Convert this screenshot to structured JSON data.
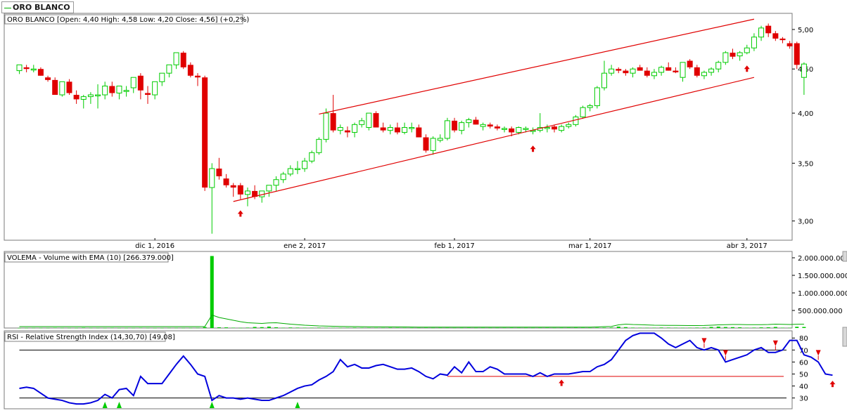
{
  "window_title": "ORO BLANCO",
  "colors": {
    "up": "#00cc00",
    "down": "#e00000",
    "line": "#0000dd",
    "trend": "#e00000",
    "ema": "#00aa00"
  },
  "chart_data": [
    {
      "type": "candlestick",
      "title": "ORO BLANCO [Open: 4,40  High: 4,58  Low: 4,20  Close: 4,56] (+0,2%)",
      "y_scale": "log",
      "ylim": [
        2.85,
        5.22
      ],
      "y_ticks": [
        "5,00",
        "4,50",
        "4,00",
        "3,50",
        "3,00"
      ],
      "y_tick_values": [
        5.0,
        4.5,
        4.0,
        3.5,
        3.0
      ],
      "x_tick_labels": [
        "dic 1, 2016",
        "ene 2, 2017",
        "feb 1, 2017",
        "mar 1, 2017",
        "abr 3, 2017"
      ],
      "x_tick_index": [
        19,
        40,
        61,
        80,
        102
      ],
      "candles": [
        [
          4.48,
          4.55,
          4.44,
          4.55
        ],
        [
          4.52,
          4.55,
          4.46,
          4.5
        ],
        [
          4.5,
          4.55,
          4.46,
          4.5
        ],
        [
          4.5,
          4.52,
          4.42,
          4.42
        ],
        [
          4.4,
          4.42,
          4.35,
          4.37
        ],
        [
          4.37,
          4.4,
          4.2,
          4.2
        ],
        [
          4.2,
          4.35,
          4.18,
          4.35
        ],
        [
          4.35,
          4.38,
          4.2,
          4.22
        ],
        [
          4.2,
          4.25,
          4.1,
          4.15
        ],
        [
          4.15,
          4.2,
          4.05,
          4.18
        ],
        [
          4.18,
          4.23,
          4.1,
          4.2
        ],
        [
          4.2,
          4.32,
          4.05,
          4.2
        ],
        [
          4.2,
          4.35,
          4.15,
          4.3
        ],
        [
          4.3,
          4.35,
          4.18,
          4.22
        ],
        [
          4.22,
          4.3,
          4.15,
          4.3
        ],
        [
          4.25,
          4.3,
          4.18,
          4.25
        ],
        [
          4.28,
          4.4,
          4.22,
          4.4
        ],
        [
          4.42,
          4.45,
          4.15,
          4.25
        ],
        [
          4.22,
          4.3,
          4.1,
          4.2
        ],
        [
          4.2,
          4.35,
          4.15,
          4.35
        ],
        [
          4.35,
          4.45,
          4.3,
          4.45
        ],
        [
          4.45,
          4.55,
          4.4,
          4.55
        ],
        [
          4.55,
          4.7,
          4.5,
          4.7
        ],
        [
          4.7,
          4.72,
          4.5,
          4.52
        ],
        [
          4.55,
          4.58,
          4.4,
          4.42
        ],
        [
          4.42,
          4.45,
          4.3,
          4.4
        ],
        [
          4.4,
          4.42,
          3.25,
          3.28
        ],
        [
          3.28,
          3.5,
          2.9,
          3.45
        ],
        [
          3.45,
          3.55,
          3.35,
          3.38
        ],
        [
          3.36,
          3.4,
          3.28,
          3.3
        ],
        [
          3.3,
          3.32,
          3.2,
          3.28
        ],
        [
          3.3,
          3.32,
          3.18,
          3.22
        ],
        [
          3.22,
          3.28,
          3.12,
          3.25
        ],
        [
          3.25,
          3.3,
          3.18,
          3.2
        ],
        [
          3.2,
          3.25,
          3.15,
          3.25
        ],
        [
          3.25,
          3.3,
          3.2,
          3.3
        ],
        [
          3.3,
          3.38,
          3.25,
          3.35
        ],
        [
          3.35,
          3.42,
          3.32,
          3.4
        ],
        [
          3.4,
          3.48,
          3.38,
          3.45
        ],
        [
          3.45,
          3.52,
          3.4,
          3.45
        ],
        [
          3.45,
          3.55,
          3.42,
          3.52
        ],
        [
          3.52,
          3.62,
          3.5,
          3.6
        ],
        [
          3.6,
          3.75,
          3.58,
          3.73
        ],
        [
          3.73,
          4.05,
          3.7,
          4.0
        ],
        [
          4.0,
          4.2,
          3.8,
          3.82
        ],
        [
          3.82,
          3.88,
          3.78,
          3.85
        ],
        [
          3.82,
          3.86,
          3.75,
          3.8
        ],
        [
          3.8,
          3.9,
          3.75,
          3.88
        ],
        [
          3.88,
          3.95,
          3.85,
          3.92
        ],
        [
          3.85,
          4.0,
          3.82,
          4.0
        ],
        [
          4.0,
          4.02,
          3.85,
          3.85
        ],
        [
          3.85,
          3.9,
          3.8,
          3.82
        ],
        [
          3.82,
          3.88,
          3.78,
          3.85
        ],
        [
          3.85,
          3.9,
          3.78,
          3.8
        ],
        [
          3.8,
          3.9,
          3.78,
          3.85
        ],
        [
          3.85,
          3.9,
          3.8,
          3.85
        ],
        [
          3.85,
          3.88,
          3.75,
          3.75
        ],
        [
          3.75,
          3.78,
          3.6,
          3.62
        ],
        [
          3.62,
          3.76,
          3.58,
          3.74
        ],
        [
          3.72,
          3.78,
          3.7,
          3.74
        ],
        [
          3.74,
          3.95,
          3.72,
          3.92
        ],
        [
          3.92,
          3.95,
          3.8,
          3.82
        ],
        [
          3.82,
          3.92,
          3.78,
          3.9
        ],
        [
          3.9,
          3.95,
          3.85,
          3.93
        ],
        [
          3.93,
          3.96,
          3.88,
          3.88
        ],
        [
          3.86,
          3.9,
          3.82,
          3.88
        ],
        [
          3.88,
          3.9,
          3.84,
          3.86
        ],
        [
          3.86,
          3.88,
          3.82,
          3.84
        ],
        [
          3.84,
          3.86,
          3.8,
          3.84
        ],
        [
          3.84,
          3.86,
          3.76,
          3.8
        ],
        [
          3.8,
          3.86,
          3.78,
          3.85
        ],
        [
          3.84,
          3.86,
          3.8,
          3.84
        ],
        [
          3.82,
          3.85,
          3.78,
          3.82
        ],
        [
          3.82,
          4.0,
          3.8,
          3.85
        ],
        [
          3.84,
          3.88,
          3.8,
          3.85
        ],
        [
          3.86,
          3.88,
          3.8,
          3.83
        ],
        [
          3.82,
          3.88,
          3.8,
          3.86
        ],
        [
          3.86,
          3.9,
          3.84,
          3.88
        ],
        [
          3.88,
          3.98,
          3.86,
          3.96
        ],
        [
          3.96,
          4.08,
          3.94,
          4.06
        ],
        [
          4.06,
          4.1,
          4.02,
          4.08
        ],
        [
          4.08,
          4.3,
          4.05,
          4.28
        ],
        [
          4.28,
          4.6,
          4.25,
          4.45
        ],
        [
          4.45,
          4.55,
          4.42,
          4.5
        ],
        [
          4.5,
          4.52,
          4.45,
          4.48
        ],
        [
          4.48,
          4.5,
          4.42,
          4.45
        ],
        [
          4.45,
          4.52,
          4.4,
          4.5
        ],
        [
          4.52,
          4.55,
          4.48,
          4.48
        ],
        [
          4.48,
          4.52,
          4.4,
          4.42
        ],
        [
          4.42,
          4.5,
          4.38,
          4.46
        ],
        [
          4.46,
          4.54,
          4.42,
          4.52
        ],
        [
          4.52,
          4.58,
          4.48,
          4.48
        ],
        [
          4.48,
          4.52,
          4.45,
          4.46
        ],
        [
          4.4,
          4.58,
          4.35,
          4.58
        ],
        [
          4.6,
          4.62,
          4.5,
          4.52
        ],
        [
          4.52,
          4.55,
          4.4,
          4.42
        ],
        [
          4.42,
          4.48,
          4.38,
          4.46
        ],
        [
          4.46,
          4.52,
          4.42,
          4.5
        ],
        [
          4.5,
          4.6,
          4.46,
          4.58
        ],
        [
          4.58,
          4.72,
          4.55,
          4.7
        ],
        [
          4.7,
          4.75,
          4.62,
          4.65
        ],
        [
          4.66,
          4.72,
          4.6,
          4.7
        ],
        [
          4.7,
          4.8,
          4.68,
          4.76
        ],
        [
          4.76,
          4.95,
          4.72,
          4.9
        ],
        [
          4.9,
          5.05,
          4.85,
          5.02
        ],
        [
          5.05,
          5.08,
          4.9,
          4.95
        ],
        [
          4.95,
          4.98,
          4.85,
          4.88
        ],
        [
          4.88,
          4.9,
          4.82,
          4.86
        ],
        [
          4.82,
          4.85,
          4.75,
          4.78
        ],
        [
          4.82,
          4.84,
          4.5,
          4.55
        ],
        [
          4.4,
          4.58,
          4.2,
          4.56
        ]
      ],
      "trend_upper": [
        [
          42,
          3.99
        ],
        [
          103,
          5.14
        ]
      ],
      "trend_lower": [
        [
          30,
          3.16
        ],
        [
          103,
          4.4
        ]
      ],
      "arrows_up_index": [
        31,
        72,
        102
      ]
    },
    {
      "type": "bar",
      "title": "VOLEMA - Volume with EMA (10) [266.379.000]",
      "y_ticks": [
        "2.000.000.000",
        "1.500.000.000",
        "1.000.000.000",
        "500.000.000"
      ],
      "y_tick_values": [
        2000000000,
        1500000000,
        1000000000,
        500000000
      ],
      "ylim": [
        0,
        2180000000
      ],
      "values": [
        2,
        3,
        5,
        5,
        3,
        10,
        5,
        4,
        3,
        12,
        5,
        4,
        3,
        8,
        2,
        3,
        4,
        9,
        4,
        2,
        3,
        6,
        5,
        4,
        5,
        6,
        28,
        2050,
        20,
        18,
        10,
        5,
        12,
        30,
        25,
        40,
        20,
        8,
        15,
        12,
        10,
        10,
        12,
        8,
        10,
        8,
        10,
        12,
        10,
        10,
        9,
        8,
        12,
        10,
        8,
        8,
        6,
        10,
        6,
        8,
        8,
        6,
        7,
        10,
        6,
        8,
        6,
        6,
        8,
        10,
        8,
        8,
        6,
        8,
        10,
        6,
        8,
        10,
        12,
        10,
        8,
        12,
        14,
        15,
        40,
        25,
        12,
        10,
        8,
        10,
        14,
        12,
        10,
        8,
        10,
        12,
        14,
        30,
        40,
        28,
        25,
        20,
        10,
        12,
        18,
        20,
        30,
        10,
        8,
        35,
        30
      ],
      "volume_scale_to_units": 1000000,
      "ema_values": [
        40,
        40,
        40,
        40,
        40,
        40,
        40,
        40,
        40,
        40,
        40,
        40,
        40,
        40,
        40,
        40,
        40,
        40,
        40,
        40,
        40,
        40,
        40,
        40,
        40,
        40,
        42,
        370,
        300,
        260,
        220,
        180,
        150,
        140,
        130,
        145,
        150,
        130,
        110,
        95,
        80,
        70,
        60,
        55,
        50,
        45,
        42,
        40,
        38,
        36,
        34,
        32,
        32,
        30,
        30,
        28,
        26,
        26,
        25,
        25,
        24,
        24,
        24,
        24,
        24,
        24,
        24,
        24,
        24,
        24,
        24,
        24,
        24,
        24,
        24,
        24,
        24,
        24,
        24,
        24,
        24,
        30,
        40,
        45,
        90,
        110,
        100,
        95,
        88,
        80,
        78,
        76,
        74,
        72,
        70,
        70,
        72,
        80,
        90,
        95,
        100,
        100,
        96,
        95,
        96,
        100,
        110,
        105,
        100,
        108,
        110
      ]
    },
    {
      "type": "line",
      "title": "RSI - Relative Strength Index (14,30,70) [49,08]",
      "y_ticks": [
        "80",
        "70",
        "60",
        "50",
        "40",
        "30"
      ],
      "y_tick_values": [
        80,
        70,
        60,
        50,
        40,
        30
      ],
      "ylim": [
        21,
        86
      ],
      "levels": [
        70,
        30
      ],
      "support_level": 48,
      "values": [
        38,
        39,
        38,
        34,
        30,
        29,
        28,
        26,
        25,
        25,
        26,
        28,
        33,
        30,
        37,
        38,
        32,
        48,
        42,
        42,
        42,
        50,
        58,
        65,
        58,
        50,
        48,
        28,
        32,
        30,
        30,
        29,
        30,
        29,
        28,
        28,
        30,
        32,
        35,
        38,
        40,
        41,
        45,
        48,
        52,
        62,
        56,
        58,
        55,
        55,
        57,
        58,
        56,
        54,
        54,
        55,
        52,
        48,
        46,
        50,
        49,
        56,
        51,
        60,
        52,
        52,
        56,
        54,
        50,
        50,
        50,
        50,
        48,
        51,
        48,
        50,
        50,
        50,
        51,
        52,
        52,
        56,
        58,
        62,
        70,
        78,
        82,
        84,
        84,
        84,
        80,
        75,
        72,
        75,
        78,
        72,
        70,
        72,
        70,
        60,
        62,
        64,
        66,
        70,
        72,
        68,
        68,
        70,
        78,
        78,
        66,
        64,
        60,
        50,
        49
      ],
      "arrows_down_index": [
        96,
        99,
        106,
        112
      ],
      "arrows_up_index": [
        12,
        14,
        27,
        39,
        76,
        114
      ]
    }
  ]
}
